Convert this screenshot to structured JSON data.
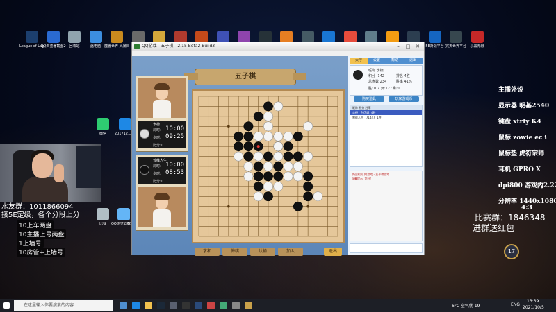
{
  "desktop_icons": [
    {
      "label": "League of Legends",
      "color": "#1c3f6e"
    },
    {
      "label": "QQ浏览器截图20210...",
      "color": "#2a6ad1"
    },
    {
      "label": "回收站",
      "color": "#90a4ae"
    },
    {
      "label": "此电脑",
      "color": "#3c8ee0"
    },
    {
      "label": "魔兽世界·风暴日...",
      "color": "#c98a1e"
    },
    {
      "label": "...",
      "color": "#6a6a6a"
    },
    {
      "label": "...",
      "color": "#d4a73b"
    },
    {
      "label": "...",
      "color": "#b03a2e"
    },
    {
      "label": "...",
      "color": "#c44a1a"
    },
    {
      "label": "...",
      "color": "#3f51b5"
    },
    {
      "label": "...",
      "color": "#8e44ad"
    },
    {
      "label": "...",
      "color": "#263238"
    },
    {
      "label": "...",
      "color": "#e67e22"
    },
    {
      "label": "...",
      "color": "#455a64"
    },
    {
      "label": "...",
      "color": "#1976d2"
    },
    {
      "label": "...",
      "color": "#e74c3c"
    },
    {
      "label": "...",
      "color": "#607d8b"
    },
    {
      "label": "...",
      "color": "#f39c12"
    },
    {
      "label": "...",
      "color": "#2c3e50"
    },
    {
      "label": "5E对战平台",
      "color": "#1565c0"
    },
    {
      "label": "完美世界平台",
      "color": "#37474f"
    },
    {
      "label": "小黑无限",
      "color": "#c62828"
    }
  ],
  "side_icons": [
    {
      "label": "微信",
      "color": "#2ecc71"
    },
    {
      "label": "20171212...",
      "color": "#1e88e5"
    },
    {
      "label": "比赛",
      "color": "#b0bec5"
    },
    {
      "label": "QQ浏览器截图20210122...",
      "color": "#64b5f6"
    }
  ],
  "overlay": {
    "group": "水友群：1011866094",
    "rank": "接5E定级，各个分段上分",
    "rewards": [
      "10上车两盘",
      "10主播上号两盘",
      "1上墙号",
      "10房管+上墙号"
    ]
  },
  "specs": {
    "title": "主播外设",
    "items": [
      "显示器 明基2540",
      "键盘 xtrfy K4",
      "鼠标 zowie ec3",
      "鼠标垫 虎符宗师",
      "耳机 GPRO X",
      "dpi800 游戏内2.22",
      "分辨率 1440x1080",
      "4:3"
    ],
    "contest_group_label": "比赛群：",
    "contest_group_number": "1846348",
    "contest_hint": "进群送红包",
    "medal": "17"
  },
  "game_window": {
    "title": "QQ游戏 - 五子棋 - 2.15 Beta2 Build3",
    "banner": "五子棋",
    "player_top": {
      "name": "李德",
      "time_label": "局时:",
      "time1": "10:00",
      "step_label": "步时:",
      "time2": "09:25",
      "score": "比分:0"
    },
    "player_bottom": {
      "name": "曾维人生",
      "time_label": "局时:",
      "time1": "10:00",
      "step_label": "步时:",
      "time2": "08:53",
      "score": "比分:0"
    },
    "buttons": [
      "求和",
      "悔棋",
      "认输",
      "加入",
      "退出"
    ],
    "right_tabs": [
      "大厅",
      "设置",
      "帮助",
      "退出"
    ],
    "profile": {
      "name": "李德",
      "score_label": "积分",
      "score": "-142",
      "rank_label": "排名",
      "rank": "4胜",
      "total_label": "总盘数",
      "total": "234",
      "rate_label": "胜率",
      "rate": "41%",
      "line": "胜:107  负:127  和:0"
    },
    "profile_buttons": [
      "购买道具",
      "玩家游戏币"
    ],
    "user_list_header": "昵称      积分      胜率",
    "users": [
      {
        "name": "李德",
        "score": "70742",
        "rate": "4胜"
      },
      {
        "name": "曾维人生",
        "score": "71447",
        "rate": "1胜"
      }
    ],
    "chat": [
      "欢迎来到QQ游戏 - 五子棋游戏",
      "温馨提示: 您好!"
    ]
  },
  "board": {
    "size": 15,
    "black_stones": [
      [
        7,
        1
      ],
      [
        6,
        2
      ],
      [
        5,
        3
      ],
      [
        4,
        4
      ],
      [
        5,
        4
      ],
      [
        10,
        4
      ],
      [
        4,
        5
      ],
      [
        6,
        5
      ],
      [
        8,
        5
      ],
      [
        9,
        5
      ],
      [
        5,
        6
      ],
      [
        7,
        6
      ],
      [
        9,
        6
      ],
      [
        10,
        6
      ],
      [
        6,
        7
      ],
      [
        8,
        7
      ],
      [
        7,
        8
      ],
      [
        8,
        8
      ],
      [
        11,
        8
      ],
      [
        6,
        9
      ],
      [
        11,
        9
      ],
      [
        7,
        10
      ],
      [
        11,
        10
      ],
      [
        10,
        11
      ],
      [
        6,
        8
      ],
      [
        5,
        5
      ]
    ],
    "white_stones": [
      [
        8,
        1
      ],
      [
        7,
        2
      ],
      [
        7,
        3
      ],
      [
        11,
        3
      ],
      [
        6,
        4
      ],
      [
        7,
        4
      ],
      [
        8,
        4
      ],
      [
        9,
        4
      ],
      [
        8,
        5
      ],
      [
        4,
        6
      ],
      [
        6,
        6
      ],
      [
        8,
        6
      ],
      [
        11,
        6
      ],
      [
        5,
        7
      ],
      [
        7,
        7
      ],
      [
        9,
        7
      ],
      [
        10,
        7
      ],
      [
        5,
        8
      ],
      [
        9,
        8
      ],
      [
        10,
        8
      ],
      [
        6,
        10
      ],
      [
        12,
        10
      ],
      [
        7,
        9
      ],
      [
        8,
        9
      ]
    ],
    "last_move": [
      6,
      5
    ]
  },
  "taskbar": {
    "search_placeholder": "在这里输入你要搜索的内容",
    "weather": "6°C  空气优 19",
    "lang": "ENG",
    "time": "13:39",
    "date": "2021/10/5"
  }
}
